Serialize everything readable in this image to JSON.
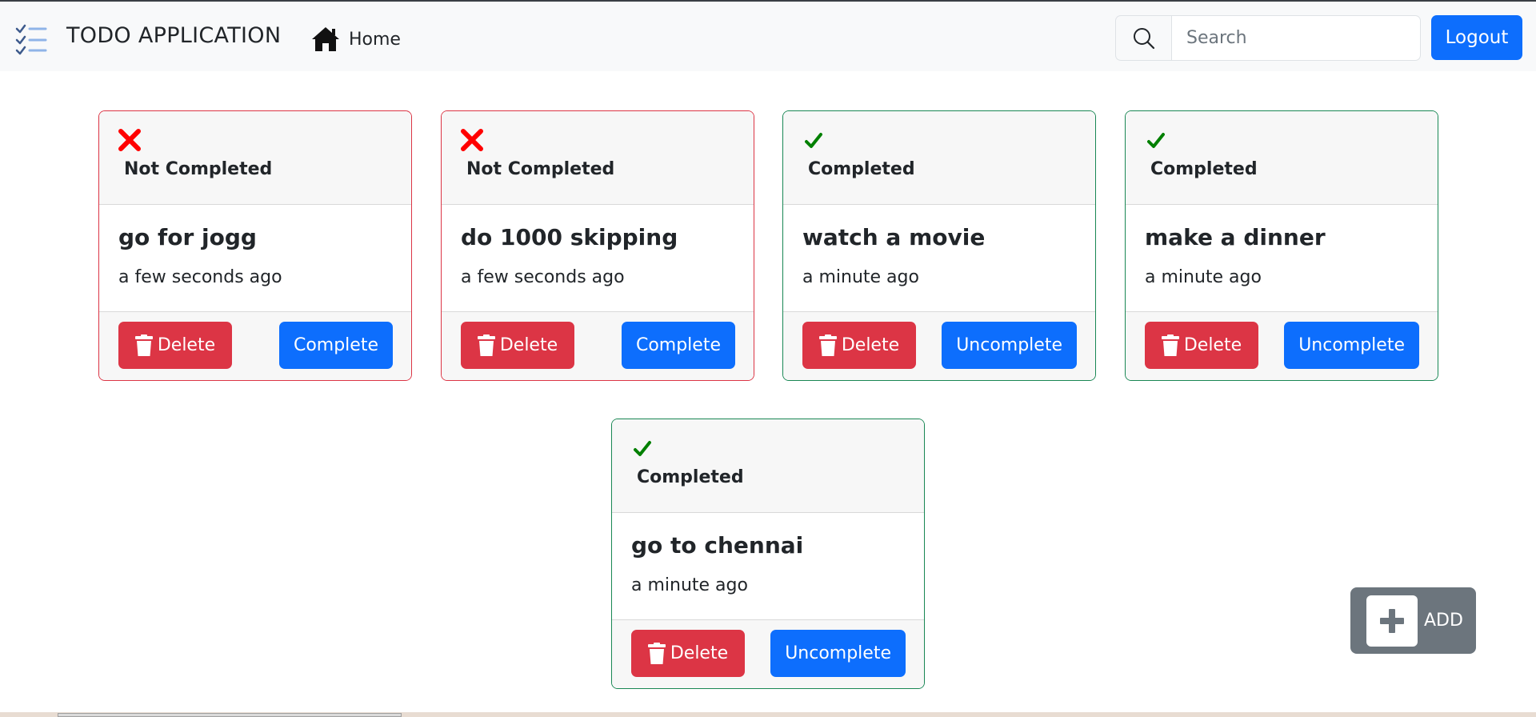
{
  "app": {
    "title": "TODO APPLICATION"
  },
  "nav": {
    "home_label": "Home"
  },
  "search": {
    "placeholder": "Search"
  },
  "logout_label": "Logout",
  "add_label": "ADD",
  "colors": {
    "primary": "#0d6efd",
    "danger": "#dc3545",
    "success": "#198754",
    "secondary": "#6c757d",
    "incomplete_icon": "#ff0000",
    "complete_icon": "#008000"
  },
  "todos": [
    {
      "status": "Not Completed",
      "title": "go for jogg",
      "time": "a few seconds ago",
      "delete_label": "Delete",
      "action_label": "Complete",
      "completed": false
    },
    {
      "status": "Not Completed",
      "title": "do 1000 skipping",
      "time": "a few seconds ago",
      "delete_label": "Delete",
      "action_label": "Complete",
      "completed": false
    },
    {
      "status": "Completed",
      "title": "watch a movie",
      "time": "a minute ago",
      "delete_label": "Delete",
      "action_label": "Uncomplete",
      "completed": true
    },
    {
      "status": "Completed",
      "title": "make a dinner",
      "time": "a minute ago",
      "delete_label": "Delete",
      "action_label": "Uncomplete",
      "completed": true
    },
    {
      "status": "Completed",
      "title": "go to chennai",
      "time": "a minute ago",
      "delete_label": "Delete",
      "action_label": "Uncomplete",
      "completed": true
    }
  ]
}
